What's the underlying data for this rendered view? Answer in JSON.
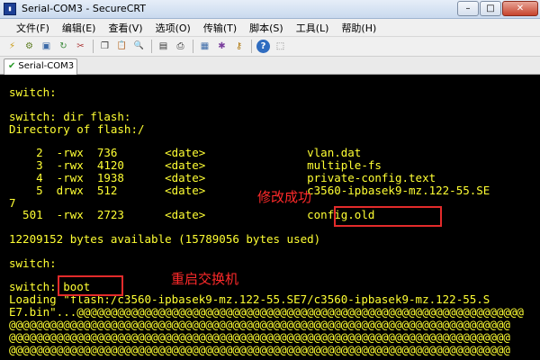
{
  "window": {
    "title": "Serial-COM3 - SecureCRT",
    "icon_name": "securecrt-app-icon",
    "controls": {
      "minimize": "–",
      "maximize": "□",
      "close": "✕"
    }
  },
  "menu": {
    "items": [
      "文件(F)",
      "编辑(E)",
      "查看(V)",
      "选项(O)",
      "传输(T)",
      "脚本(S)",
      "工具(L)",
      "帮助(H)"
    ]
  },
  "toolbar": {
    "buttons": [
      {
        "icon": "connect-icon",
        "glyph": "⚡"
      },
      {
        "icon": "quick-connect-icon",
        "glyph": "⚙"
      },
      {
        "icon": "connect-tab-icon",
        "glyph": "▣"
      },
      {
        "icon": "reconnect-icon",
        "glyph": "↻"
      },
      {
        "icon": "disconnect-icon",
        "glyph": "✂"
      },
      {
        "icon": "copy-icon",
        "glyph": "❐"
      },
      {
        "icon": "paste-icon",
        "glyph": "📋"
      },
      {
        "icon": "find-icon",
        "glyph": "🔍"
      },
      {
        "icon": "print-setup-icon",
        "glyph": "▤"
      },
      {
        "icon": "print-icon",
        "glyph": "⎙"
      },
      {
        "icon": "session-options-icon",
        "glyph": "▦"
      },
      {
        "icon": "global-options-icon",
        "glyph": "✱"
      },
      {
        "icon": "keymap-icon",
        "glyph": "⚷"
      },
      {
        "icon": "help-icon",
        "glyph": "?"
      },
      {
        "icon": "sftp-icon",
        "glyph": "⬚"
      }
    ]
  },
  "tab": {
    "label": "Serial-COM3",
    "status": "connected"
  },
  "terminal": {
    "text_color": "#ffff33",
    "lines": [
      "switch:",
      "switch: dir flash:",
      "Directory of flash:/",
      "    2  -rwx  736       <date>               vlan.dat",
      "    3  -rwx  4120      <date>               multiple-fs",
      "    4  -rwx  1938      <date>               private-config.text",
      "    5  drwx  512       <date>               c3560-ipbasek9-mz.122-55.SE",
      "7",
      "  501  -rwx  2723      <date>               config.old",
      "12209152 bytes available (15789056 bytes used)",
      "switch:",
      "switch: boot",
      "Loading \"flash:/c3560-ipbasek9-mz.122-55.SE7/c3560-ipbasek9-mz.122-55.S",
      "E7.bin\"...@@@@@@@@@@@@@@@@@@@@@@@@@@@@@@@@@@@@@@@@@@@@@@@@@@@@@@@@@@@@@@@@@@",
      "@@@@@@@@@@@@@@@@@@@@@@@@@@@@@@@@@@@@@@@@@@@@@@@@@@@@@@@@@@@@@@@@@@@@@@@@@@",
      "@@@@@@@@@@@@@@@@@@@@@@@@@@@@@@@@@@@@@@@@@@@@@@@@@@@@@@@@@@@@@@@@@@@@@@@@@@",
      "@@@@@@@@@@@@@@@@@@@@@@@@@@@@@@@@@@@@@@@@@@@@@@@@@@@@@@@@@@@@@@@@@@@@@@@@@@"
    ]
  },
  "annotations": {
    "color": "#e32b2b",
    "modify_success": "修改成功",
    "reboot_switch": "重启交换机"
  }
}
